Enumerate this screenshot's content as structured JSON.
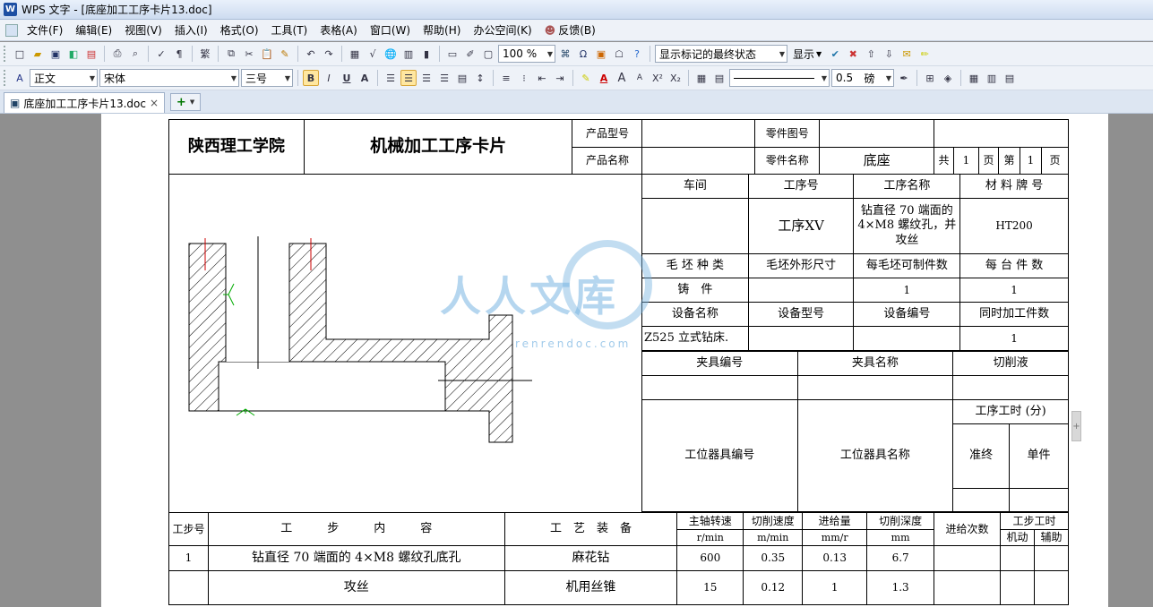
{
  "window": {
    "title": "WPS 文字 - [底座加工工序卡片13.doc]",
    "app_icon": "W"
  },
  "menu": [
    "文件(F)",
    "编辑(E)",
    "视图(V)",
    "插入(I)",
    "格式(O)",
    "工具(T)",
    "表格(A)",
    "窗口(W)",
    "帮助(H)",
    "办公空间(K)",
    "反馈(B)"
  ],
  "toolbar1": {
    "zoom": "100 %",
    "track_mode": "显示标记的最终状态",
    "show_label": "显示"
  },
  "toolbar2": {
    "style": "正文",
    "font": "宋体",
    "size": "三号",
    "line_width": "0.5",
    "line_unit": "磅",
    "bold": "B",
    "italic": "I",
    "underline": "U",
    "font_color": "A",
    "grow": "A",
    "shrink": "A",
    "superscript": "X²",
    "subscript": "X₂"
  },
  "tab": {
    "label": "底座加工工序卡片13.doc",
    "close": "×",
    "new": "+"
  },
  "card": {
    "school": "陕西理工学院",
    "title": "机械加工工序卡片",
    "product_model_label": "产品型号",
    "part_drawing_no_label": "零件图号",
    "product_name_label": "产品名称",
    "part_name_label": "零件名称",
    "part_name": "底座",
    "total_label": "共",
    "total_pages": "1",
    "page_unit": "页",
    "page_label": "第",
    "page_no": "1",
    "page_unit2": "页",
    "workshop_label": "车间",
    "process_no_label": "工序号",
    "process_name_label": "工序名称",
    "material_label": "材 料 牌 号",
    "process_no": "工序XV",
    "process_name": "钻直径 70 端面的 4×M8 螺纹孔，并攻丝",
    "material": "HT200",
    "blank_type_label": "毛 坯 种 类",
    "blank_shape_label": "毛坯外形尺寸",
    "parts_per_blank_label": "每毛坯可制件数",
    "parts_per_machine_label": "每 台 件 数",
    "blank_type": "铸　件",
    "parts_per_blank": "1",
    "parts_per_machine": "1",
    "equip_name_label": "设备名称",
    "equip_model_label": "设备型号",
    "equip_no_label": "设备编号",
    "simul_parts_label": "同时加工件数",
    "equip_name": "Z525 立式钻床.",
    "simul_parts": "1",
    "fixture_no_label": "夹具编号",
    "fixture_name_label": "夹具名称",
    "coolant_label": "切削液",
    "station_tool_no_label": "工位器具编号",
    "station_tool_name_label": "工位器具名称",
    "process_time_label": "工序工时 (分)",
    "prep_label": "准终",
    "unit_label": "单件"
  },
  "steps": {
    "headers": {
      "step_no": "工步号",
      "content": "工　　　步　　　内　　　容",
      "equipment": "工　艺　装　备",
      "spindle": "主轴转速",
      "spindle_unit": "r/min",
      "cut_speed": "切削速度",
      "cut_speed_unit": "m/min",
      "feed": "进给量",
      "feed_unit": "mm/r",
      "depth": "切削深度",
      "depth_unit": "mm",
      "passes": "进给次数",
      "step_time": "工步工时",
      "machine": "机动",
      "aux": "辅助"
    },
    "rows": [
      {
        "no": "1",
        "content": "钻直径 70 端面的 4×M8 螺纹孔底孔",
        "equipment": "麻花钻",
        "spindle": "600",
        "cut_speed": "0.35",
        "feed": "0.13",
        "depth": "6.7"
      },
      {
        "no": "",
        "content": "攻丝",
        "equipment": "机用丝锥",
        "spindle": "15",
        "cut_speed": "0.12",
        "feed": "1",
        "depth": "1.3"
      }
    ]
  },
  "watermark": {
    "text": "人人文库",
    "sub": "renrendoc.com"
  }
}
